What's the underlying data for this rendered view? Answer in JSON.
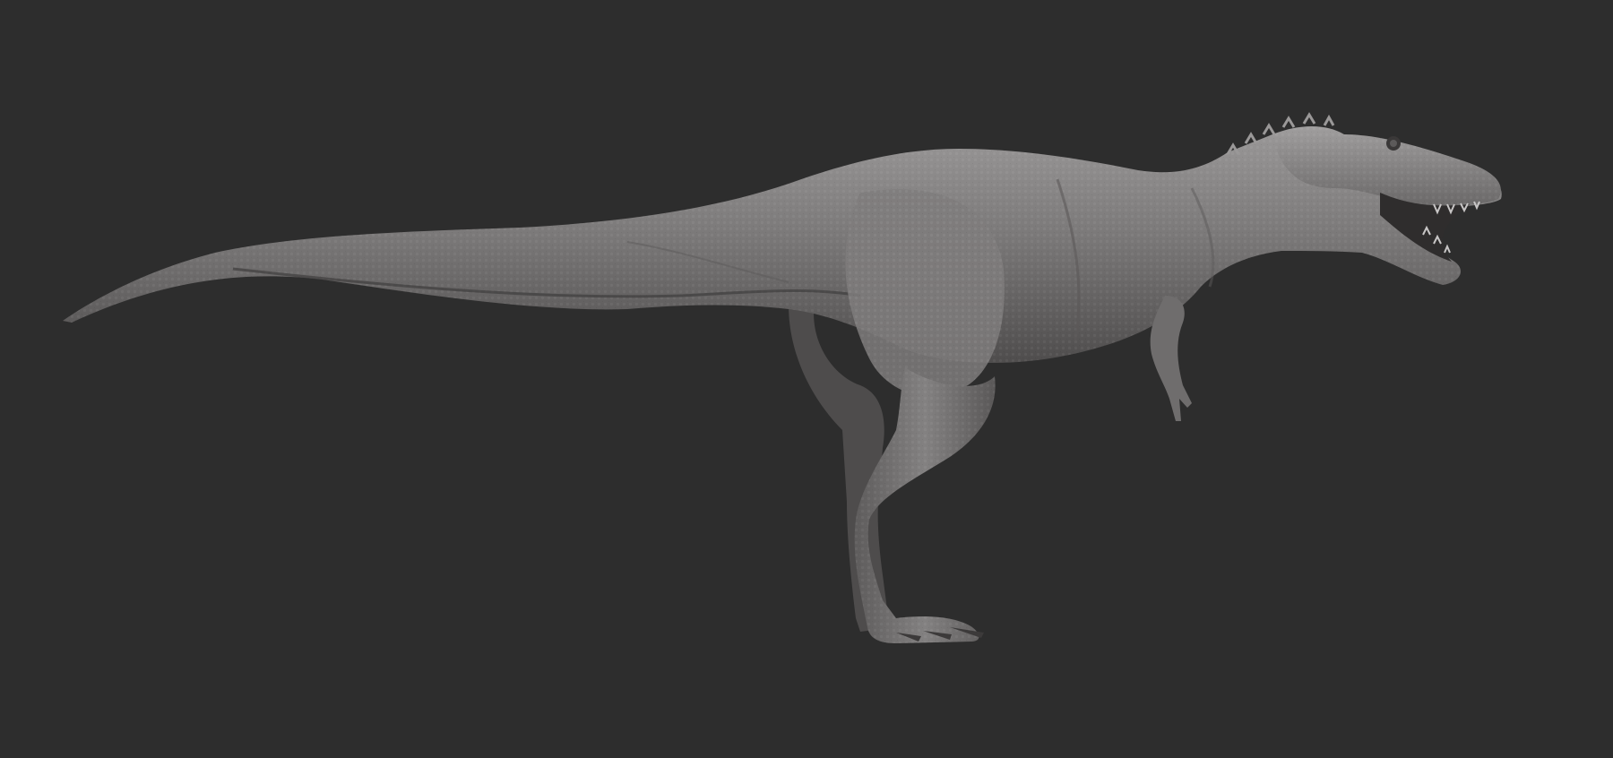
{
  "scene": {
    "background_color": "#2d2d2d",
    "model_color": "#7a7878",
    "model_shadow_color": "#4a4848",
    "model_highlight_color": "#a4a2a2",
    "subject": "tyrannosaur-sculpt-side-view"
  }
}
